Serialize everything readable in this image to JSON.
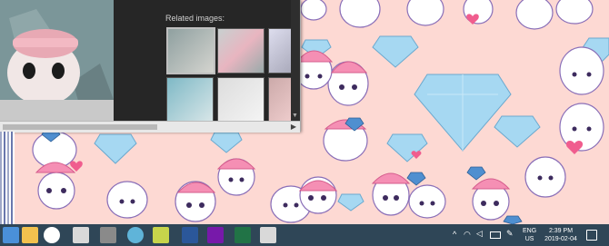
{
  "image_viewer": {
    "related_images_label": "Related images:"
  },
  "tray": {
    "language_top": "ENG",
    "language_bottom": "US",
    "time": "2:39 PM",
    "date": "2019-02-04",
    "chevron": "^"
  },
  "taskbar_icons": [
    "start-icon",
    "file-explorer-icon",
    "media-player-icon",
    "game-icon",
    "browser-icon",
    "app-icon",
    "sketch-app-icon",
    "word-icon",
    "onenote-icon",
    "excel-icon",
    "presentation-icon"
  ],
  "colors": {
    "taskbar": "#2f4657",
    "wallpaper": "#fdd9d3",
    "diamond": "#9fd3ef",
    "window_dark": "#1f1f1f"
  }
}
